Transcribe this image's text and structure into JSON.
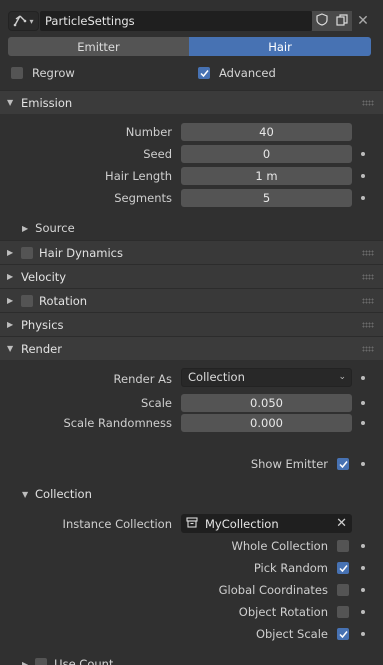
{
  "header": {
    "datablock_name": "ParticleSettings",
    "type_icon": "particle-icon",
    "fake_user_icon": "shield-icon",
    "duplicate_icon": "copy-icon",
    "unlink_icon": "close-icon"
  },
  "tabs": {
    "emitter": "Emitter",
    "hair": "Hair",
    "active": "Hair"
  },
  "options": {
    "regrow_label": "Regrow",
    "regrow_checked": false,
    "advanced_label": "Advanced",
    "advanced_checked": true
  },
  "emission": {
    "title": "Emission",
    "number_label": "Number",
    "number_value": "40",
    "seed_label": "Seed",
    "seed_value": "0",
    "hair_length_label": "Hair Length",
    "hair_length_value": "1 m",
    "segments_label": "Segments",
    "segments_value": "5",
    "source_label": "Source"
  },
  "panels": {
    "hair_dynamics": "Hair Dynamics",
    "velocity": "Velocity",
    "rotation": "Rotation",
    "physics": "Physics",
    "render": "Render"
  },
  "render": {
    "render_as_label": "Render As",
    "render_as_value": "Collection",
    "scale_label": "Scale",
    "scale_value": "0.050",
    "scale_randomness_label": "Scale Randomness",
    "scale_randomness_value": "0.000",
    "show_emitter_label": "Show Emitter",
    "show_emitter_checked": true
  },
  "collection": {
    "title": "Collection",
    "instance_collection_label": "Instance Collection",
    "instance_collection_value": "MyCollection",
    "whole_collection_label": "Whole Collection",
    "whole_collection_checked": false,
    "pick_random_label": "Pick Random",
    "pick_random_checked": true,
    "global_coordinates_label": "Global Coordinates",
    "global_coordinates_checked": false,
    "object_rotation_label": "Object Rotation",
    "object_rotation_checked": false,
    "object_scale_label": "Object Scale",
    "object_scale_checked": true,
    "use_count_label": "Use Count"
  },
  "colors": {
    "accent": "#4772b3",
    "background": "#303030",
    "field": "#545454"
  }
}
